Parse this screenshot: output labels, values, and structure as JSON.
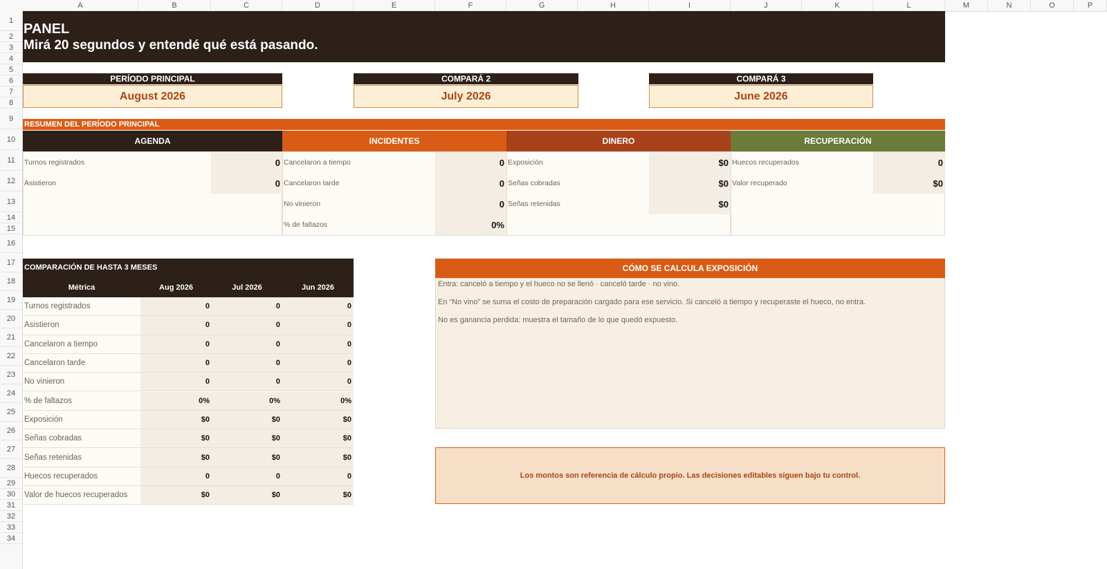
{
  "columns": [
    "A",
    "B",
    "C",
    "D",
    "E",
    "F",
    "G",
    "H",
    "I",
    "J",
    "K",
    "L",
    "M",
    "N",
    "O",
    "P"
  ],
  "rows": [
    "1",
    "2",
    "3",
    "4",
    "5",
    "6",
    "7",
    "8",
    "9",
    "10",
    "11",
    "12",
    "13",
    "14",
    "15",
    "16",
    "17",
    "18",
    "19",
    "20",
    "21",
    "22",
    "23",
    "24",
    "25",
    "26",
    "27",
    "28",
    "29",
    "30",
    "31",
    "32",
    "33",
    "34"
  ],
  "header": {
    "title": "PANEL",
    "subtitle": "Mirá 20 segundos y entendé qué está pasando."
  },
  "periods": {
    "main_label": "PERÍODO PRINCIPAL",
    "main_value": "August 2026",
    "compare2_label": "COMPARÁ 2",
    "compare2_value": "July 2026",
    "compare3_label": "COMPARÁ 3",
    "compare3_value": "June 2026"
  },
  "summary": {
    "title": "RESUMEN DEL PERÍODO PRINCIPAL",
    "colors": {
      "agenda": "#2c2019",
      "incidentes": "#d95c16",
      "dinero": "#a9411a",
      "recuperacion": "#6b7b3a"
    },
    "agenda": {
      "title": "AGENDA",
      "items": [
        {
          "label": "Turnos registrados",
          "value": "0"
        },
        {
          "label": "Asistieron",
          "value": "0"
        }
      ]
    },
    "incidentes": {
      "title": "INCIDENTES",
      "items": [
        {
          "label": "Cancelaron a tiempo",
          "value": "0"
        },
        {
          "label": "Cancelaron tarde",
          "value": "0"
        },
        {
          "label": "No vinieron",
          "value": "0"
        },
        {
          "label": "% de faltazos",
          "value": "0%"
        }
      ]
    },
    "dinero": {
      "title": "DINERO",
      "items": [
        {
          "label": "Exposición",
          "value": "$0"
        },
        {
          "label": "Señas cobradas",
          "value": "$0"
        },
        {
          "label": "Señas retenidas",
          "value": "$0"
        }
      ]
    },
    "recuperacion": {
      "title": "RECUPERACIÓN",
      "items": [
        {
          "label": "Huecos recuperados",
          "value": "0"
        },
        {
          "label": "Valor recuperado",
          "value": "$0"
        }
      ]
    }
  },
  "comparison": {
    "title": "COMPARACIÓN DE HASTA 3 MESES",
    "headers": [
      "Métrica",
      "Aug 2026",
      "Jul 2026",
      "Jun 2026"
    ],
    "rows": [
      {
        "label": "Turnos registrados",
        "values": [
          "0",
          "0",
          "0"
        ]
      },
      {
        "label": "Asistieron",
        "values": [
          "0",
          "0",
          "0"
        ]
      },
      {
        "label": "Cancelaron a tiempo",
        "values": [
          "0",
          "0",
          "0"
        ]
      },
      {
        "label": "Cancelaron tarde",
        "values": [
          "0",
          "0",
          "0"
        ]
      },
      {
        "label": "No vinieron",
        "values": [
          "0",
          "0",
          "0"
        ]
      },
      {
        "label": "% de faltazos",
        "values": [
          "0%",
          "0%",
          "0%"
        ]
      },
      {
        "label": "Exposición",
        "values": [
          "$0",
          "$0",
          "$0"
        ]
      },
      {
        "label": "Señas cobradas",
        "values": [
          "$0",
          "$0",
          "$0"
        ]
      },
      {
        "label": "Señas retenidas",
        "values": [
          "$0",
          "$0",
          "$0"
        ]
      },
      {
        "label": "Huecos recuperados",
        "values": [
          "0",
          "0",
          "0"
        ]
      },
      {
        "label": "Valor de huecos recuperados",
        "values": [
          "$0",
          "$0",
          "$0"
        ]
      }
    ]
  },
  "info": {
    "title": "CÓMO SE CALCULA EXPOSICIÓN",
    "line1": "Entra: canceló a tiempo y el hueco no se llenó · canceló tarde · no vino.",
    "line2": "En “No vino” se suma el costo de preparación cargado para ese servicio. Si canceló a tiempo y recuperaste el hueco, no entra.",
    "line3": "No es ganancia perdida: muestra el tamaño de lo que quedó expuesto."
  },
  "note": "Los montos son referencia de cálculo propio. Las decisiones editables siguen bajo tu control."
}
